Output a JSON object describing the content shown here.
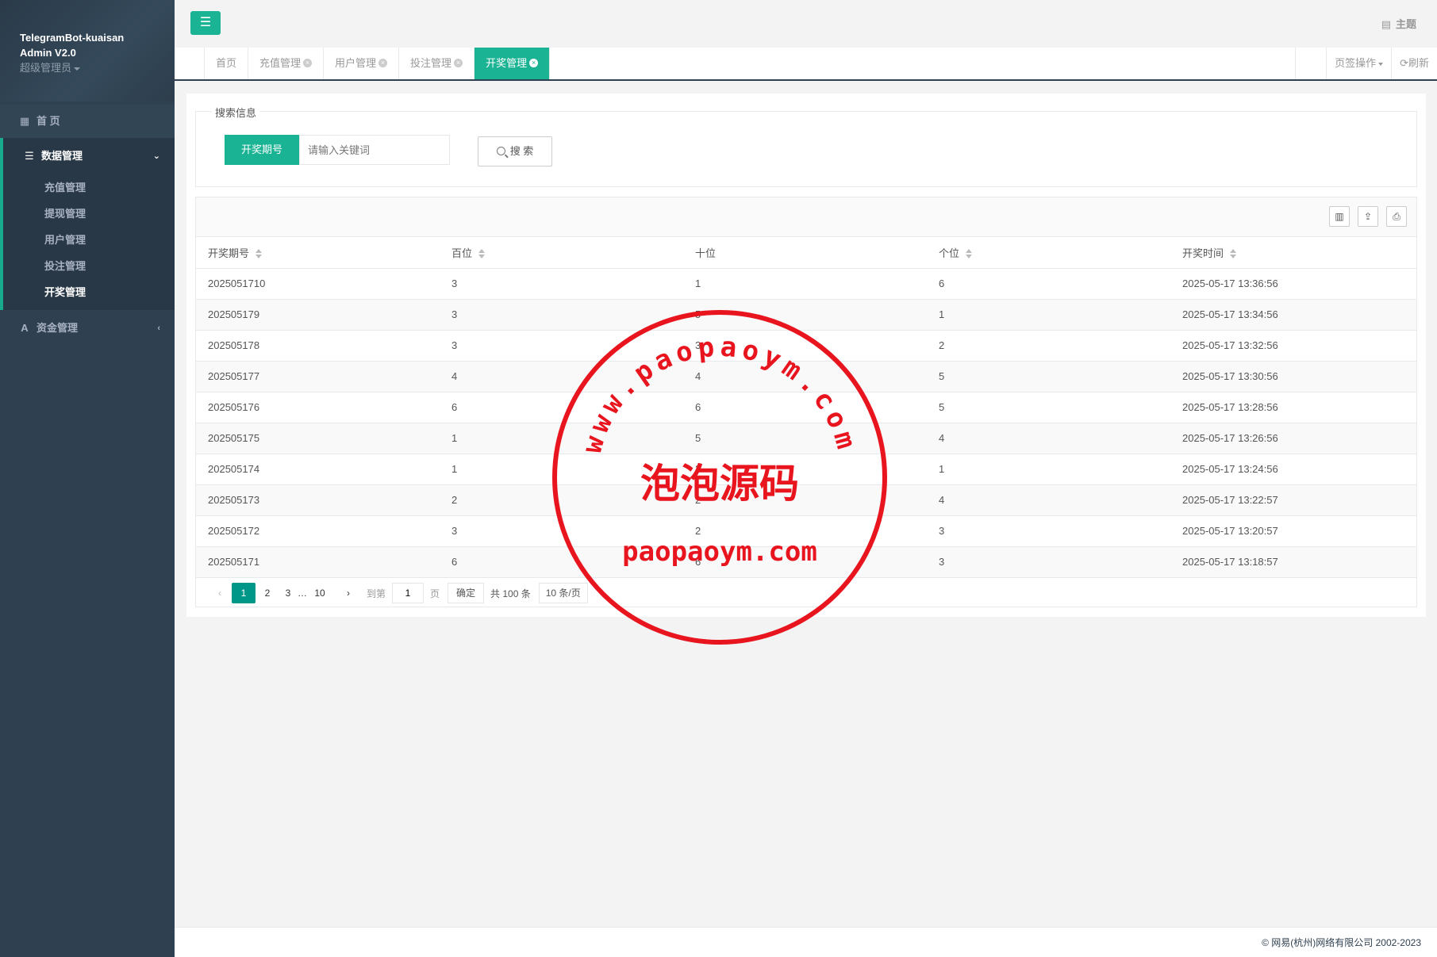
{
  "sidebar": {
    "app_name_line1": "TelegramBot-kuaisan",
    "app_name_line2": "Admin V2.0",
    "role": "超级管理员",
    "home_label": "首 页",
    "data_group_label": "数据管理",
    "data_items": [
      "充值管理",
      "提现管理",
      "用户管理",
      "投注管理",
      "开奖管理"
    ],
    "fund_label": "资金管理"
  },
  "topbar": {
    "theme_label": "主题"
  },
  "tabs": [
    {
      "label": "首页"
    },
    {
      "label": "充值管理"
    },
    {
      "label": "用户管理"
    },
    {
      "label": "投注管理"
    },
    {
      "label": "开奖管理"
    }
  ],
  "tab_actions": {
    "page_ops": "页签操作",
    "refresh": "刷新"
  },
  "search": {
    "legend": "搜索信息",
    "field_label": "开奖期号",
    "placeholder": "请输入关键词",
    "button_label": "搜 索"
  },
  "table": {
    "columns": [
      "开奖期号",
      "百位",
      "十位",
      "个位",
      "开奖时间"
    ],
    "rows": [
      [
        "2025051710",
        "3",
        "1",
        "6",
        "2025-05-17 13:36:56"
      ],
      [
        "202505179",
        "3",
        "5",
        "1",
        "2025-05-17 13:34:56"
      ],
      [
        "202505178",
        "3",
        "3",
        "2",
        "2025-05-17 13:32:56"
      ],
      [
        "202505177",
        "4",
        "4",
        "5",
        "2025-05-17 13:30:56"
      ],
      [
        "202505176",
        "6",
        "6",
        "5",
        "2025-05-17 13:28:56"
      ],
      [
        "202505175",
        "1",
        "5",
        "4",
        "2025-05-17 13:26:56"
      ],
      [
        "202505174",
        "1",
        "3",
        "1",
        "2025-05-17 13:24:56"
      ],
      [
        "202505173",
        "2",
        "2",
        "4",
        "2025-05-17 13:22:57"
      ],
      [
        "202505172",
        "3",
        "2",
        "3",
        "2025-05-17 13:20:57"
      ],
      [
        "202505171",
        "6",
        "6",
        "3",
        "2025-05-17 13:18:57"
      ]
    ]
  },
  "pagination": {
    "pages": [
      "1",
      "2",
      "3",
      "…",
      "10"
    ],
    "current": "1",
    "goto_label": "到第",
    "goto_value": "1",
    "page_unit": "页",
    "confirm": "确定",
    "total": "共 100 条",
    "page_size": "10 条/页"
  },
  "watermark": {
    "arc_text": "www.paopaoym.com",
    "center_text": "泡泡源码",
    "bottom_text": "paopaoym.com",
    "color": "#e8141e"
  },
  "footer": {
    "copyright": "© 网易(杭州)网络有限公司 2002-2023"
  },
  "colors": {
    "sidebar_bg": "#2f4050",
    "accent": "#1ab394"
  }
}
